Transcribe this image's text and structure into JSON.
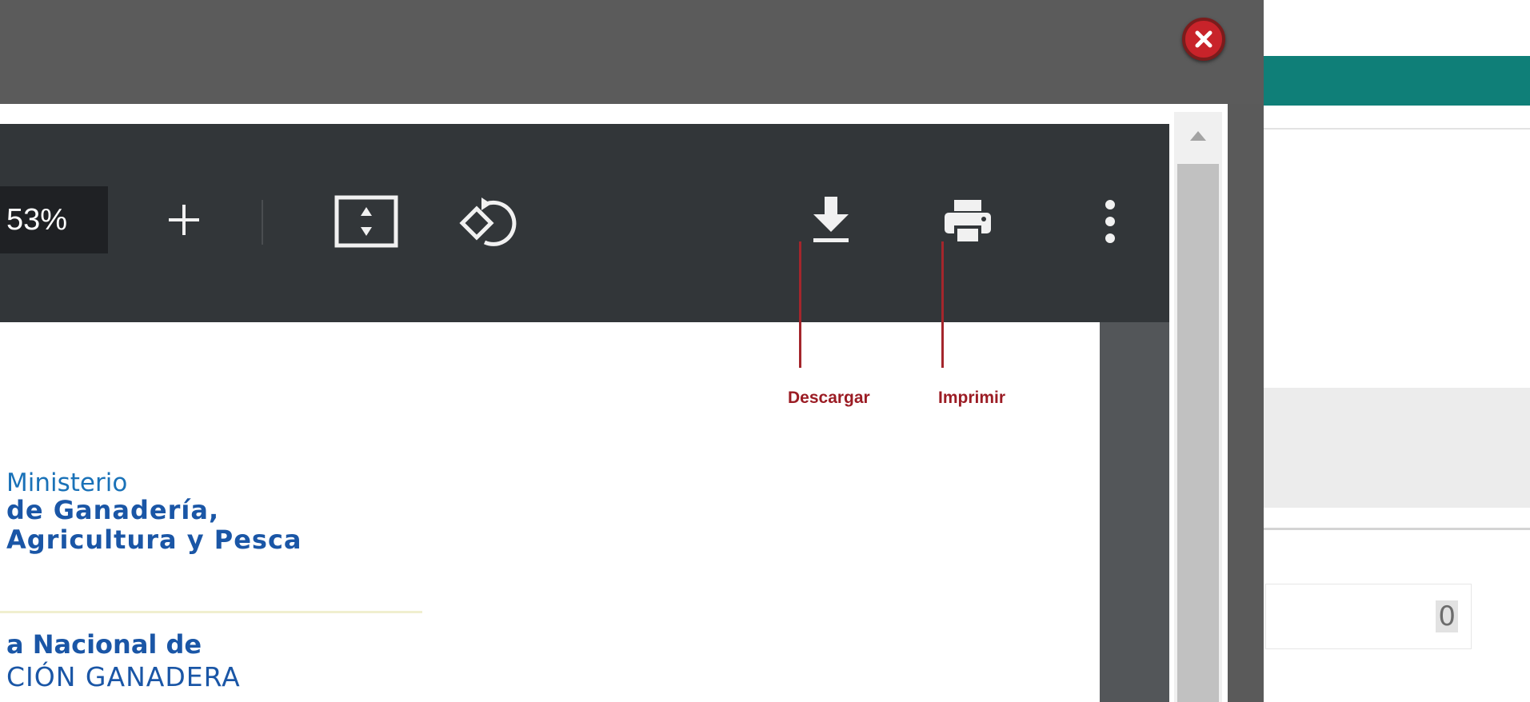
{
  "pdf_viewer": {
    "zoom_level": "53%",
    "toolbar": {
      "zoom_in_icon": "plus-icon",
      "fit_page_icon": "fit-to-page-icon",
      "rotate_icon": "rotate-icon",
      "download_icon": "download-icon",
      "print_icon": "print-icon",
      "more_icon": "more-vert-icon"
    }
  },
  "document": {
    "logo_line1": "Ministerio",
    "logo_line2": "de Ganadería,",
    "logo_line3": "Agricultura y Pesca",
    "subtitle_line1": "a Nacional de",
    "subtitle_line2": "CIÓN GANADERA"
  },
  "annotations": {
    "download_label": "Descargar",
    "print_label": "Imprimir",
    "color": "#a4262c"
  },
  "background_page": {
    "field_value": "0",
    "accent_color": "#0f7f78"
  },
  "modal": {
    "close_icon": "close-icon",
    "close_color": "#c8232a"
  }
}
